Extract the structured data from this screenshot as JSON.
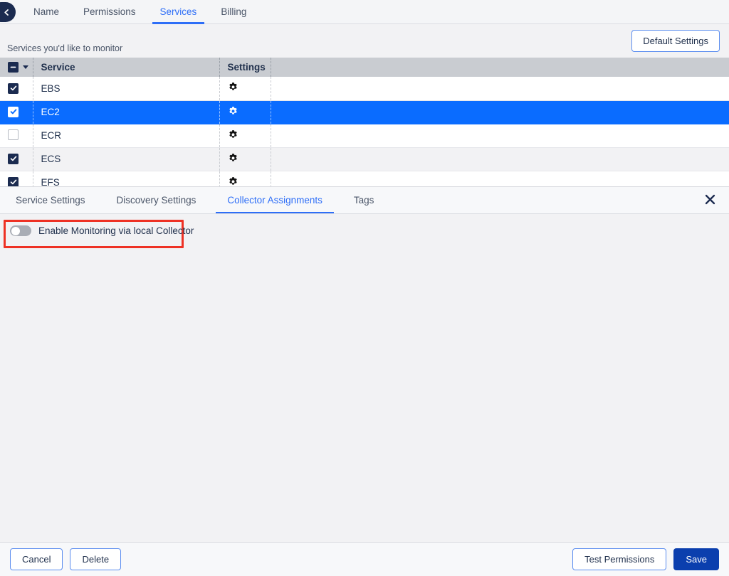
{
  "topbar": {
    "back_icon": "chevron-left-icon",
    "tabs": [
      {
        "label": "Name",
        "active": false
      },
      {
        "label": "Permissions",
        "active": false
      },
      {
        "label": "Services",
        "active": true
      },
      {
        "label": "Billing",
        "active": false
      }
    ]
  },
  "subheader": {
    "label": "Services you'd like to monitor",
    "default_settings_label": "Default Settings"
  },
  "table": {
    "headers": {
      "service": "Service",
      "settings": "Settings"
    },
    "select_all_state": "indeterminate",
    "rows": [
      {
        "name": "EBS",
        "checked": true,
        "selected": false,
        "settings_icon": "gear-icon"
      },
      {
        "name": "EC2",
        "checked": true,
        "selected": true,
        "settings_icon": "gear-icon"
      },
      {
        "name": "ECR",
        "checked": false,
        "selected": false,
        "settings_icon": "gear-icon"
      },
      {
        "name": "ECS",
        "checked": true,
        "selected": false,
        "settings_icon": "gear-icon"
      },
      {
        "name": "EFS",
        "checked": true,
        "selected": false,
        "settings_icon": "gear-icon"
      }
    ]
  },
  "panel": {
    "tabs": [
      {
        "label": "Service Settings",
        "active": false
      },
      {
        "label": "Discovery Settings",
        "active": false
      },
      {
        "label": "Collector Assignments",
        "active": true
      },
      {
        "label": "Tags",
        "active": false
      }
    ],
    "close_icon": "close-icon",
    "toggle": {
      "label": "Enable Monitoring via local Collector",
      "enabled": false
    },
    "annotation_color": "#ee3124"
  },
  "footer": {
    "cancel_label": "Cancel",
    "delete_label": "Delete",
    "test_permissions_label": "Test Permissions",
    "save_label": "Save"
  },
  "colors": {
    "accent_blue": "#2e6ef7",
    "selected_row": "#0a6cff",
    "navy": "#1b2b50",
    "primary_button": "#0b3fae",
    "annotation_red": "#ee3124"
  }
}
